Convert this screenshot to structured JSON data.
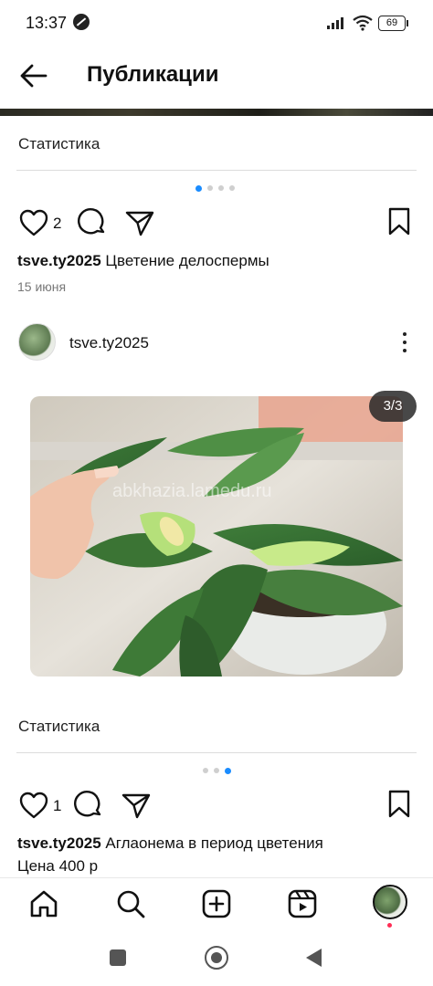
{
  "status_bar": {
    "time": "13:37",
    "battery": "69"
  },
  "header": {
    "title": "Публикации"
  },
  "post1": {
    "statistics_label": "Статистика",
    "likes": "2",
    "username": "tsve.ty2025",
    "caption": "Цветение делоспермы",
    "date": "15 июня"
  },
  "post2": {
    "username": "tsve.ty2025",
    "image_counter": "3/3",
    "watermark": "abkhazia.lamedu.ru",
    "statistics_label": "Статистика",
    "likes": "1",
    "caption_user": "tsve.ty2025",
    "caption": "Аглаонема в период цветения",
    "caption_line2": "Цена 400 р"
  },
  "icons": [
    "back-arrow-icon",
    "heart-icon",
    "comment-icon",
    "share-icon",
    "bookmark-icon",
    "more-icon",
    "home-icon",
    "search-icon",
    "create-icon",
    "reels-icon",
    "profile-avatar"
  ],
  "colors": {
    "accent": "#1a8cff",
    "notification": "#ff2d55"
  }
}
